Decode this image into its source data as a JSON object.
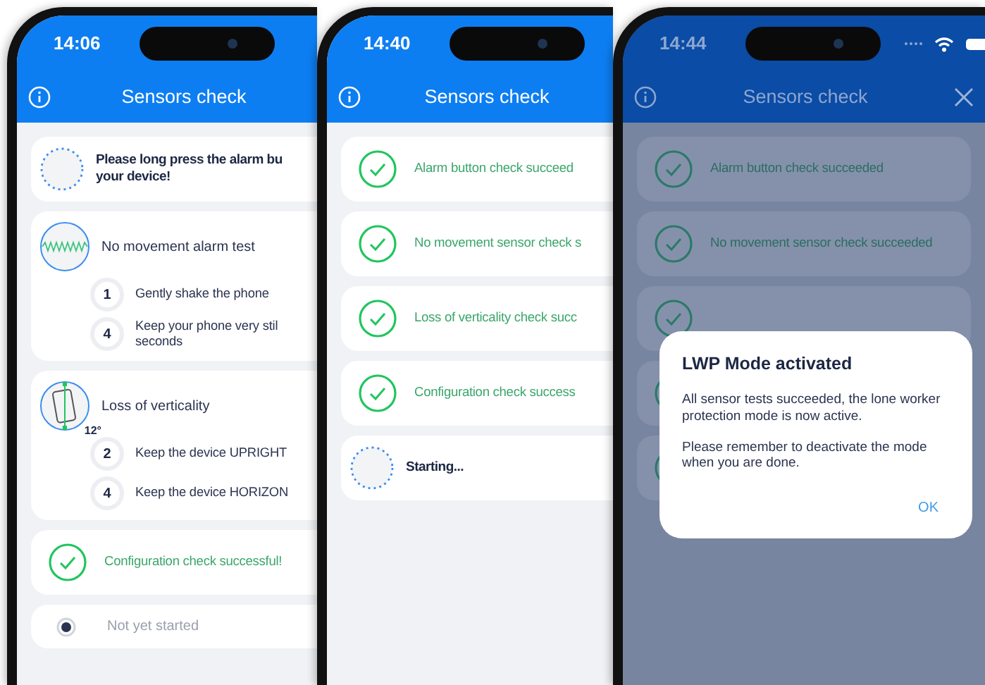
{
  "phones": [
    {
      "time": "14:06",
      "title": "Sensors check",
      "dimmed": false,
      "status_icons": false,
      "close_button": false,
      "cards": [
        {
          "kind": "waiting",
          "lines": [
            "Please long press the alarm bu",
            "your device!"
          ]
        },
        {
          "kind": "movement-test",
          "title": "No movement alarm test",
          "steps": [
            {
              "number": "1",
              "lines": [
                "Gently shake the phone"
              ]
            },
            {
              "number": "4",
              "lines": [
                "Keep your phone very stil",
                "seconds"
              ]
            }
          ]
        },
        {
          "kind": "tilt-test",
          "angle": "12°",
          "title": "Loss of verticality",
          "steps": [
            {
              "number": "2",
              "lines": [
                "Keep the device UPRIGHT"
              ]
            },
            {
              "number": "4",
              "lines": [
                "Keep the device HORIZON"
              ]
            }
          ]
        },
        {
          "kind": "success",
          "text": "Configuration check successful!"
        },
        {
          "kind": "pending",
          "text": "Not yet started"
        }
      ]
    },
    {
      "time": "14:40",
      "title": "Sensors check",
      "dimmed": false,
      "status_icons": false,
      "close_button": false,
      "cards": [
        {
          "kind": "success",
          "text": "Alarm button check succeed"
        },
        {
          "kind": "success",
          "text": "No movement sensor check s"
        },
        {
          "kind": "success",
          "text": "Loss of verticality check succ"
        },
        {
          "kind": "success",
          "text": "Configuration check success"
        },
        {
          "kind": "waiting",
          "lines": [
            "Starting..."
          ]
        }
      ]
    },
    {
      "time": "14:44",
      "title": "Sensors check",
      "dimmed": true,
      "status_icons": true,
      "close_button": true,
      "cards": [
        {
          "kind": "success",
          "text": "Alarm button check succeeded"
        },
        {
          "kind": "success",
          "text": "No movement sensor check succeeded"
        },
        {
          "kind": "success"
        },
        {
          "kind": "success"
        },
        {
          "kind": "success"
        }
      ],
      "dialog": {
        "title": "LWP Mode activated",
        "paragraphs": [
          "All sensor tests succeeded, the lone worker protection mode is now active.",
          "Please remember to deactivate the mode when you are done."
        ],
        "button": "OK"
      }
    }
  ]
}
